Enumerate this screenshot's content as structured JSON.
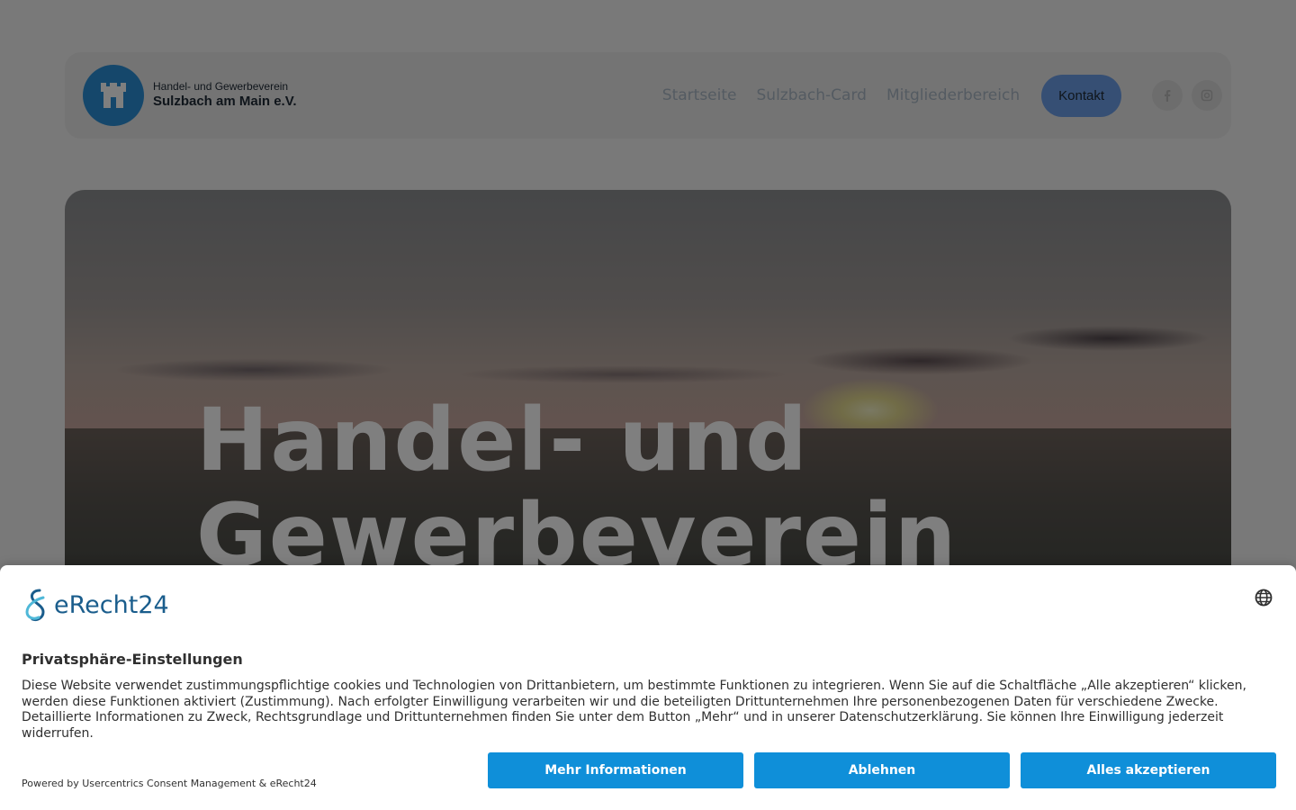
{
  "header": {
    "logo_line1": "Handel- und Gewerbeverein",
    "logo_line2": "Sulzbach am Main e.V.",
    "nav": [
      "Startseite",
      "Sulzbach-Card",
      "Mitgliederbereich"
    ],
    "contact_label": "Kontakt",
    "social_icons": [
      "facebook-icon",
      "instagram-icon"
    ]
  },
  "hero": {
    "title_line1": "Handel- und",
    "title_line2": "Gewerbeverein"
  },
  "consent": {
    "brand": "eRecht24",
    "title": "Privatsphäre-Einstellungen",
    "text": "Diese Website verwendet zustimmungspflichtige cookies und Technologien von Drittanbietern, um bestimmte Funktionen zu integrieren. Wenn Sie auf die Schaltfläche „Alle akzeptieren“ klicken, werden diese Funktionen aktiviert (Zustimmung). Nach erfolgter Einwilligung verarbeiten wir und die beteiligten Drittunternehmen Ihre personenbezogenen Daten für verschiedene Zwecke. Detaillierte Informationen zu Zweck, Rechtsgrundlage und Drittunternehmen finden Sie unter dem Button „Mehr“ und in unserer Datenschutzerklärung. Sie können Ihre Einwilligung jederzeit widerrufen.",
    "powered_by": "Powered by Usercentrics Consent Management & eRecht24",
    "buttons": {
      "more": "Mehr Informationen",
      "decline": "Ablehnen",
      "accept": "Alles akzeptieren"
    },
    "accent_color": "#0f8fd9"
  }
}
